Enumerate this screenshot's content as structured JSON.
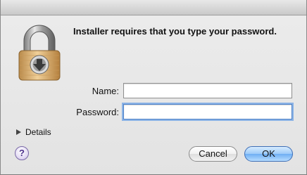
{
  "dialog": {
    "message": "Installer requires that you type your password.",
    "name_label": "Name:",
    "name_value": "",
    "password_label": "Password:",
    "password_value": "",
    "details_label": "Details",
    "help_label": "?",
    "cancel_label": "Cancel",
    "ok_label": "OK"
  },
  "icons": {
    "lock": "lock-icon",
    "details_disclosure": "disclosure-triangle-icon",
    "help": "help-icon"
  },
  "colors": {
    "focus_ring": "#8bb3e6",
    "default_button": "#6faef3",
    "help_button": "#4a2f8a"
  }
}
